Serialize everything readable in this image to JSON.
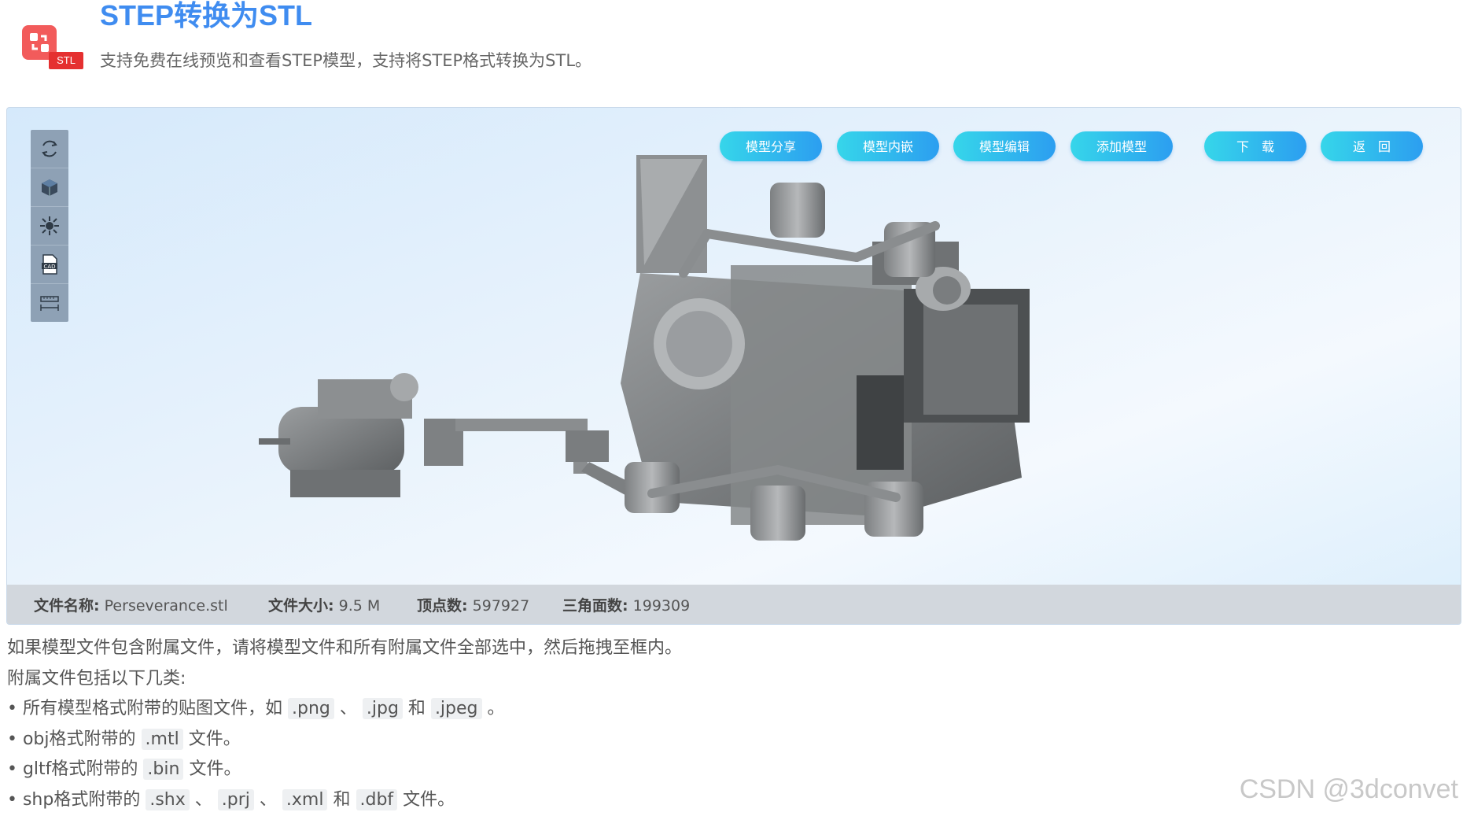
{
  "header": {
    "title": "STEP转换为STL",
    "subtitle": "支持免费在线预览和查看STEP模型，支持将STEP格式转换为STL。",
    "logo_tag": "STL"
  },
  "viewer": {
    "tools": [
      {
        "icon": "rotate-icon"
      },
      {
        "icon": "cube-icon"
      },
      {
        "icon": "explode-icon"
      },
      {
        "icon": "cad-file-icon"
      },
      {
        "icon": "measure-icon"
      }
    ],
    "buttons": {
      "share": "模型分享",
      "embed": "模型内嵌",
      "edit": "模型编辑",
      "add": "添加模型",
      "download": "下　载",
      "back": "返　回"
    },
    "info": {
      "filename_label": "文件名称:",
      "filename": "Perseverance.stl",
      "filesize_label": "文件大小:",
      "filesize": "9.5 M",
      "vertices_label": "顶点数:",
      "vertices": "597927",
      "triangles_label": "三角面数:",
      "triangles": "199309"
    }
  },
  "notes": {
    "line1": "如果模型文件包含附属文件，请将模型文件和所有附属文件全部选中，然后拖拽至框内。",
    "line2": "附属文件包括以下几类:",
    "b1_pre": "• 所有模型格式附带的贴图文件，如",
    "b1_png": ".png",
    "b1_sep1": "、",
    "b1_jpg": ".jpg",
    "b1_and": "和",
    "b1_jpeg": ".jpeg",
    "b1_end": "。",
    "b2_pre": "• obj格式附带的",
    "b2_mtl": ".mtl",
    "b2_end": "文件。",
    "b3_pre": "• gltf格式附带的",
    "b3_bin": ".bin",
    "b3_end": "文件。",
    "b4_pre": "• shp格式附带的",
    "b4_shx": ".shx",
    "b4_sep1": "、",
    "b4_prj": ".prj",
    "b4_sep2": "、",
    "b4_xml": ".xml",
    "b4_and": "和",
    "b4_dbf": ".dbf",
    "b4_end": "文件。"
  },
  "watermark": "CSDN @3dconvet"
}
